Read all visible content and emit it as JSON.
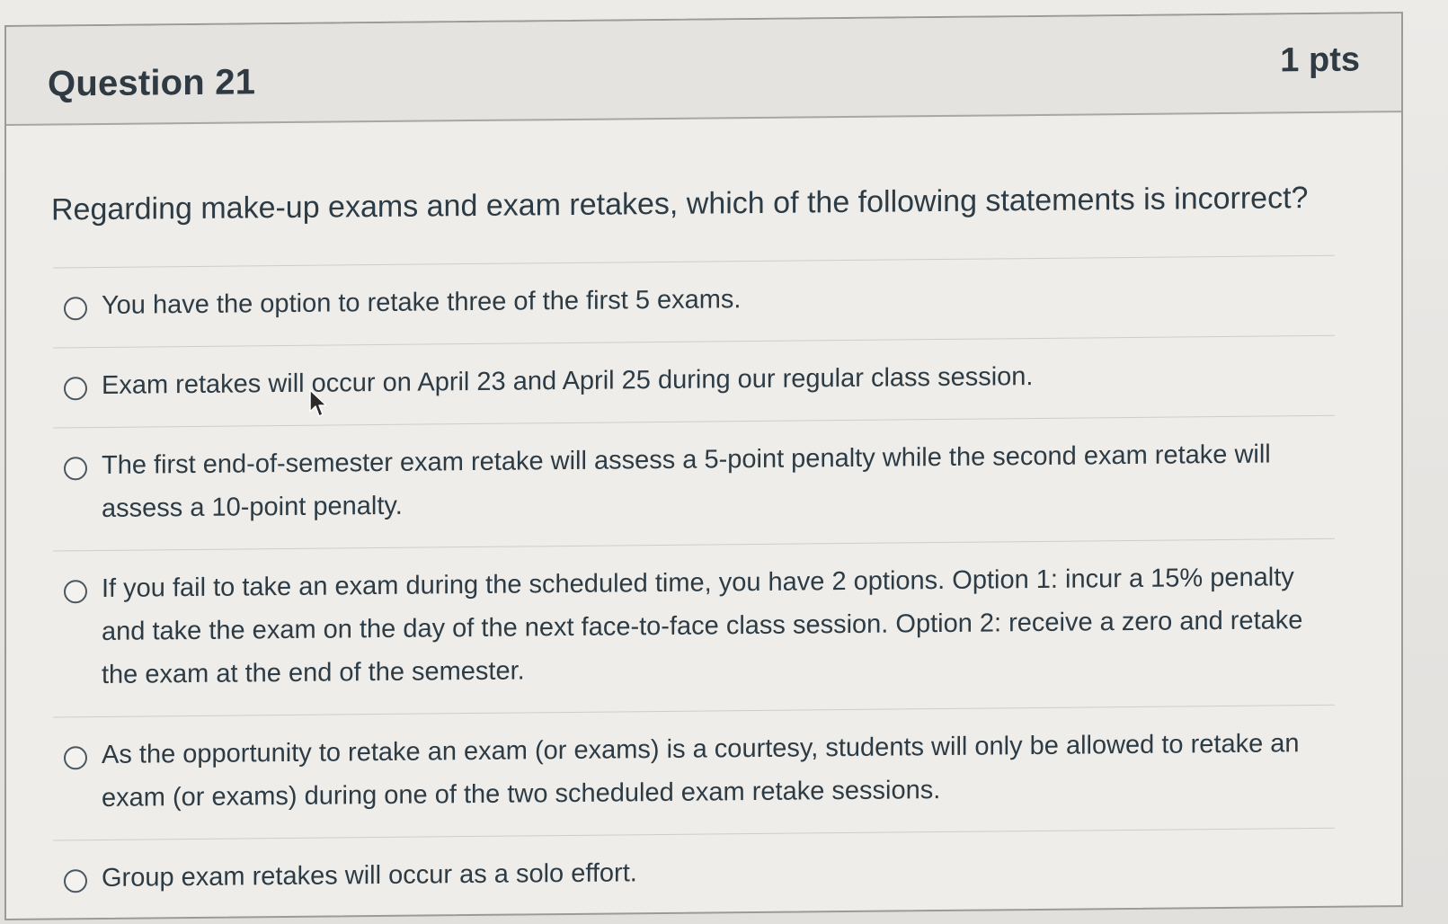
{
  "question": {
    "title": "Question 21",
    "points": "1 pts",
    "prompt": "Regarding make-up exams and exam retakes, which of the following statements is incorrect?",
    "answers": [
      {
        "label": "You have the option to retake three of the first 5 exams."
      },
      {
        "label": "Exam retakes will occur on April 23 and April 25 during our regular class session."
      },
      {
        "label": "The first end-of-semester exam retake will assess a 5-point penalty while the second exam retake will assess a 10-point penalty."
      },
      {
        "label": "If you fail to take an exam during the scheduled time, you have 2 options. Option 1: incur a 15% penalty and take the exam on the day of the next face-to-face class session. Option 2: receive a zero and retake the exam at the end of the semester."
      },
      {
        "label": "As the opportunity to retake an exam (or exams) is a courtesy, students will only be allowed to retake an exam (or exams) during one of the two scheduled exam retake sessions."
      },
      {
        "label": "Group exam retakes will occur as a solo effort."
      }
    ]
  },
  "colors": {
    "text": "#2d3b45",
    "header_bg": "#e4e3e0",
    "border": "#9b9a98"
  },
  "icons": {
    "pointer": "mouse-pointer-icon",
    "radio": "radio-button-icon"
  }
}
